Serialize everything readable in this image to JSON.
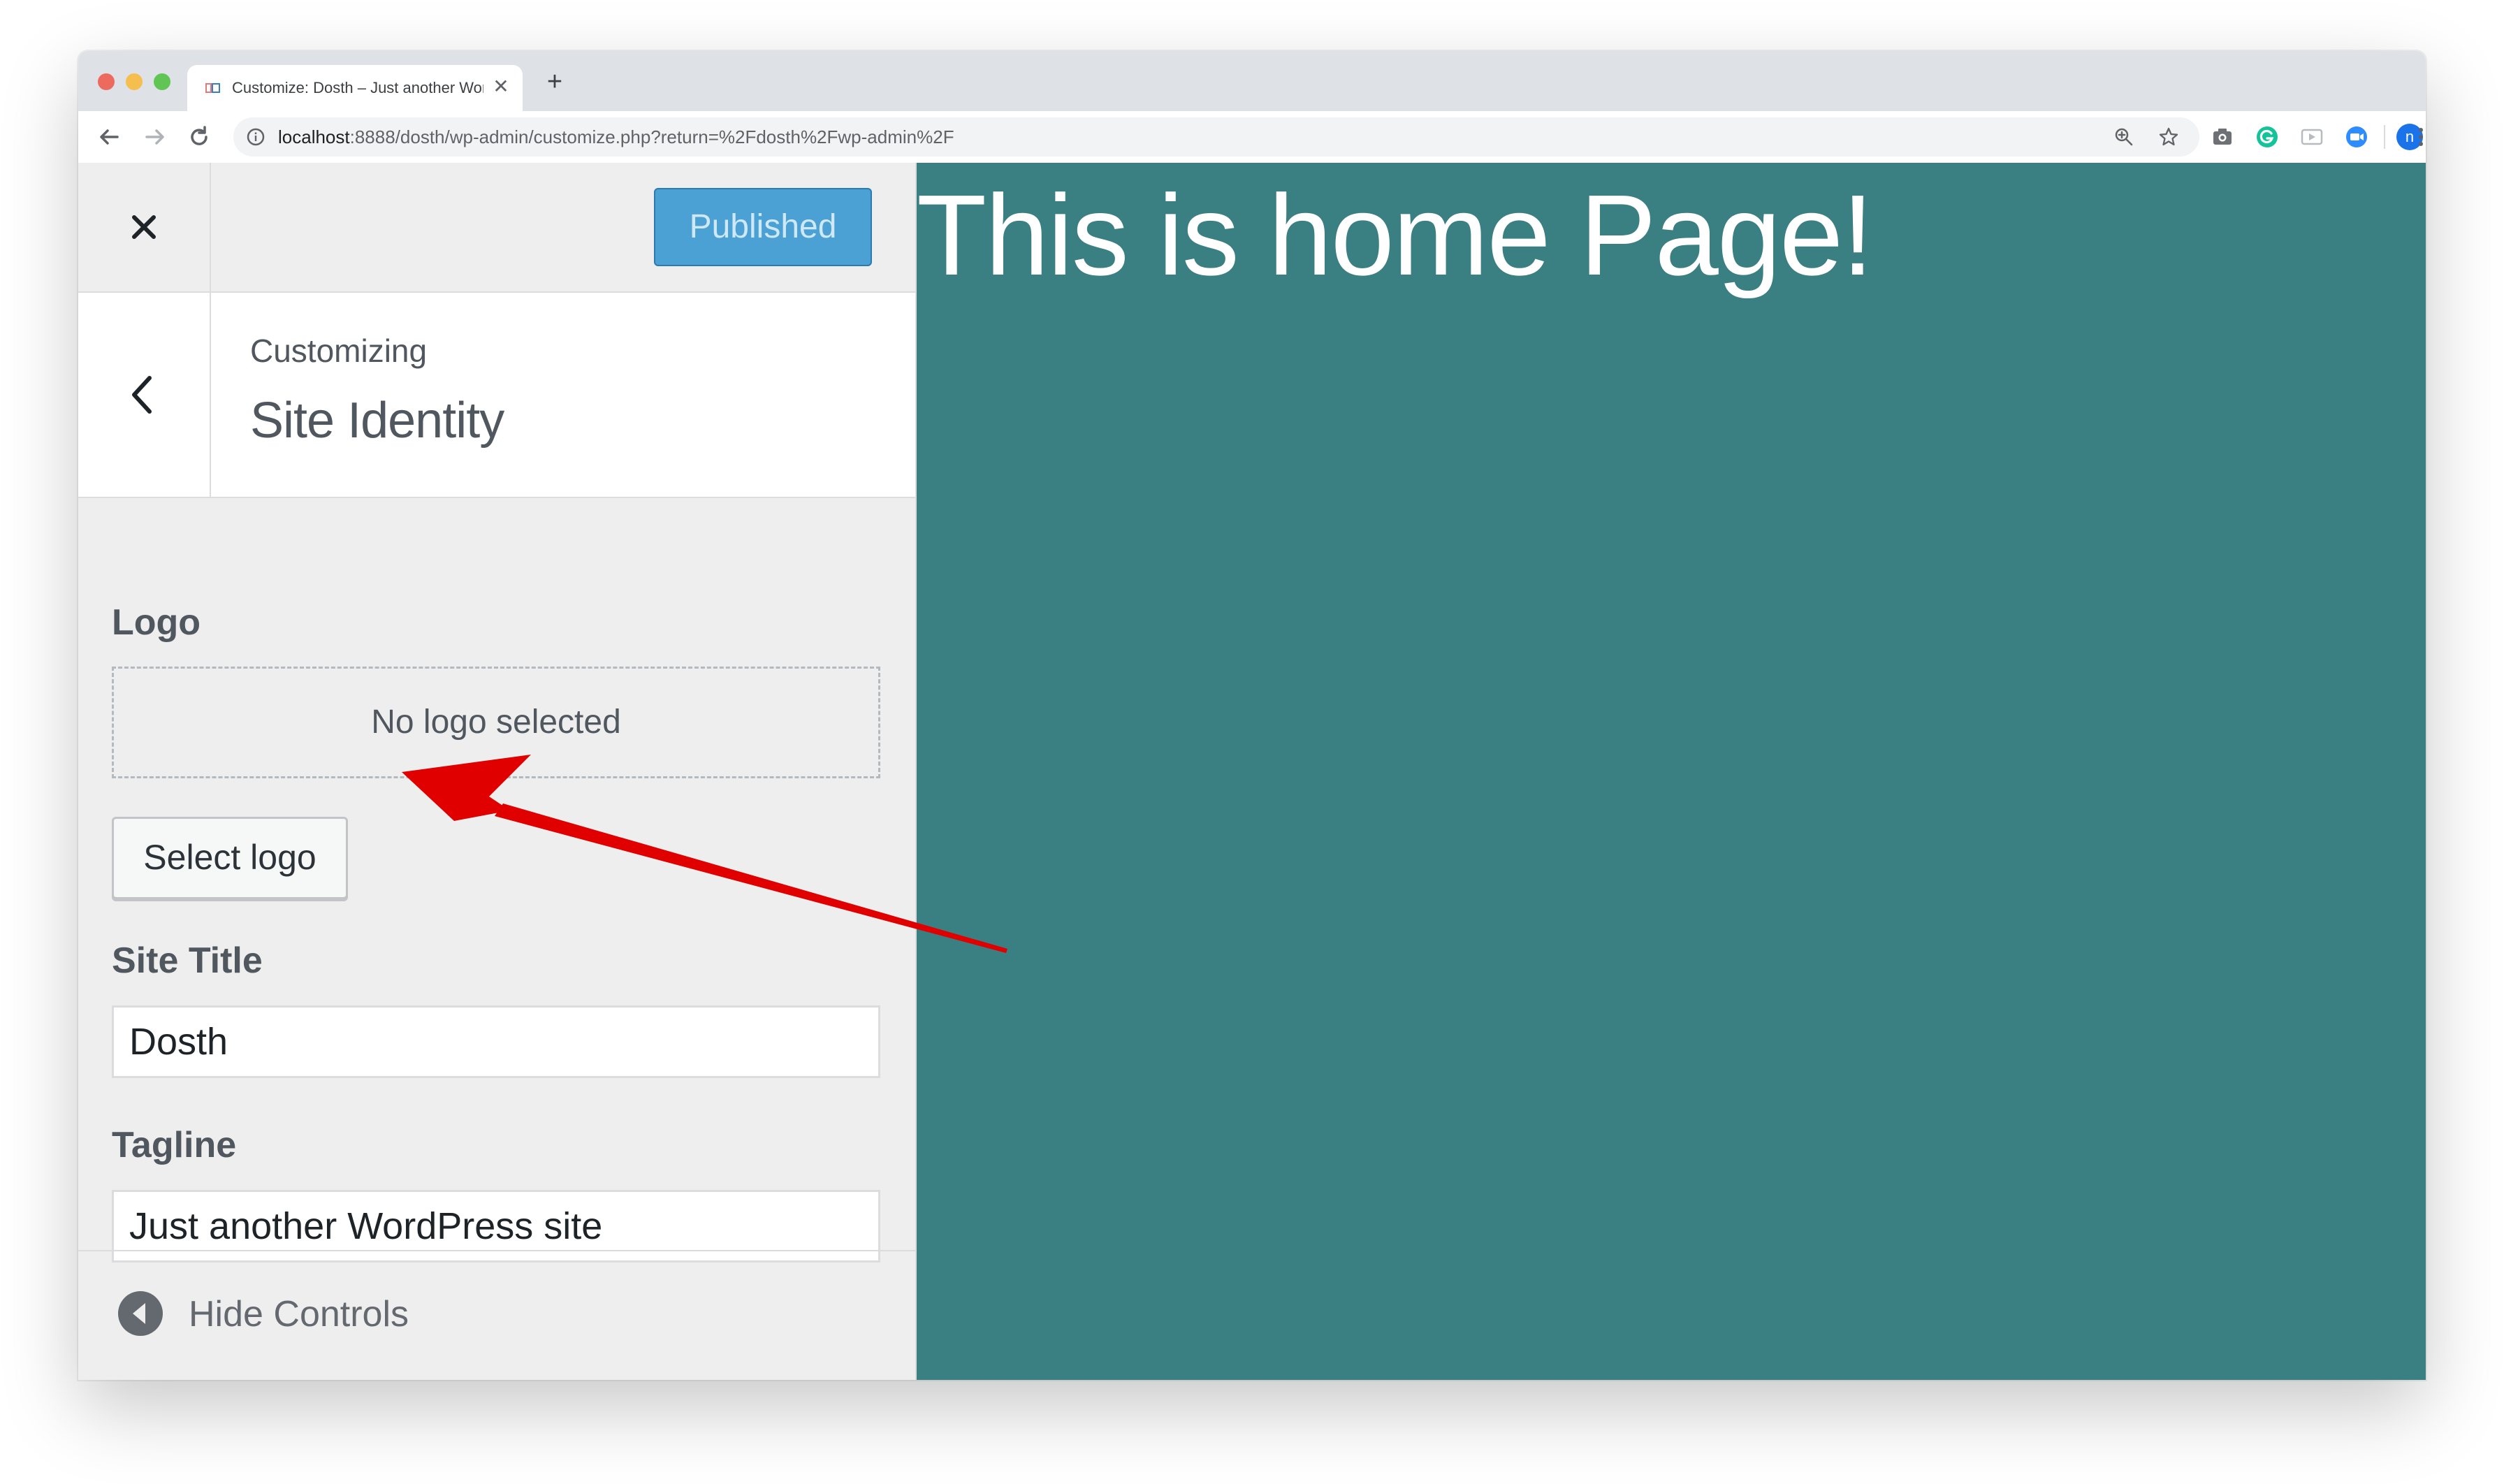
{
  "browser": {
    "tab_title": "Customize: Dosth – Just another WordPress site",
    "tab_close": "✕",
    "new_tab": "+",
    "url_host": "localhost",
    "url_rest": ":8888/dosth/wp-admin/customize.php?return=%2Fdosth%2Fwp-admin%2F",
    "profile_initial": "n"
  },
  "customizer": {
    "publish_label": "Published",
    "breadcrumb": "Customizing",
    "section_title": "Site Identity",
    "logo_label": "Logo",
    "no_logo_text": "No logo selected",
    "select_logo_label": "Select logo",
    "site_title_label": "Site Title",
    "site_title_value": "Dosth",
    "tagline_label": "Tagline",
    "tagline_value": "Just another WordPress site",
    "hide_controls_label": "Hide Controls"
  },
  "preview": {
    "heading": "This is home Page!"
  },
  "colors": {
    "preview_bg": "#3a7f82",
    "publish_button": "#4ba1d4",
    "annotation_arrow": "#e00000"
  }
}
